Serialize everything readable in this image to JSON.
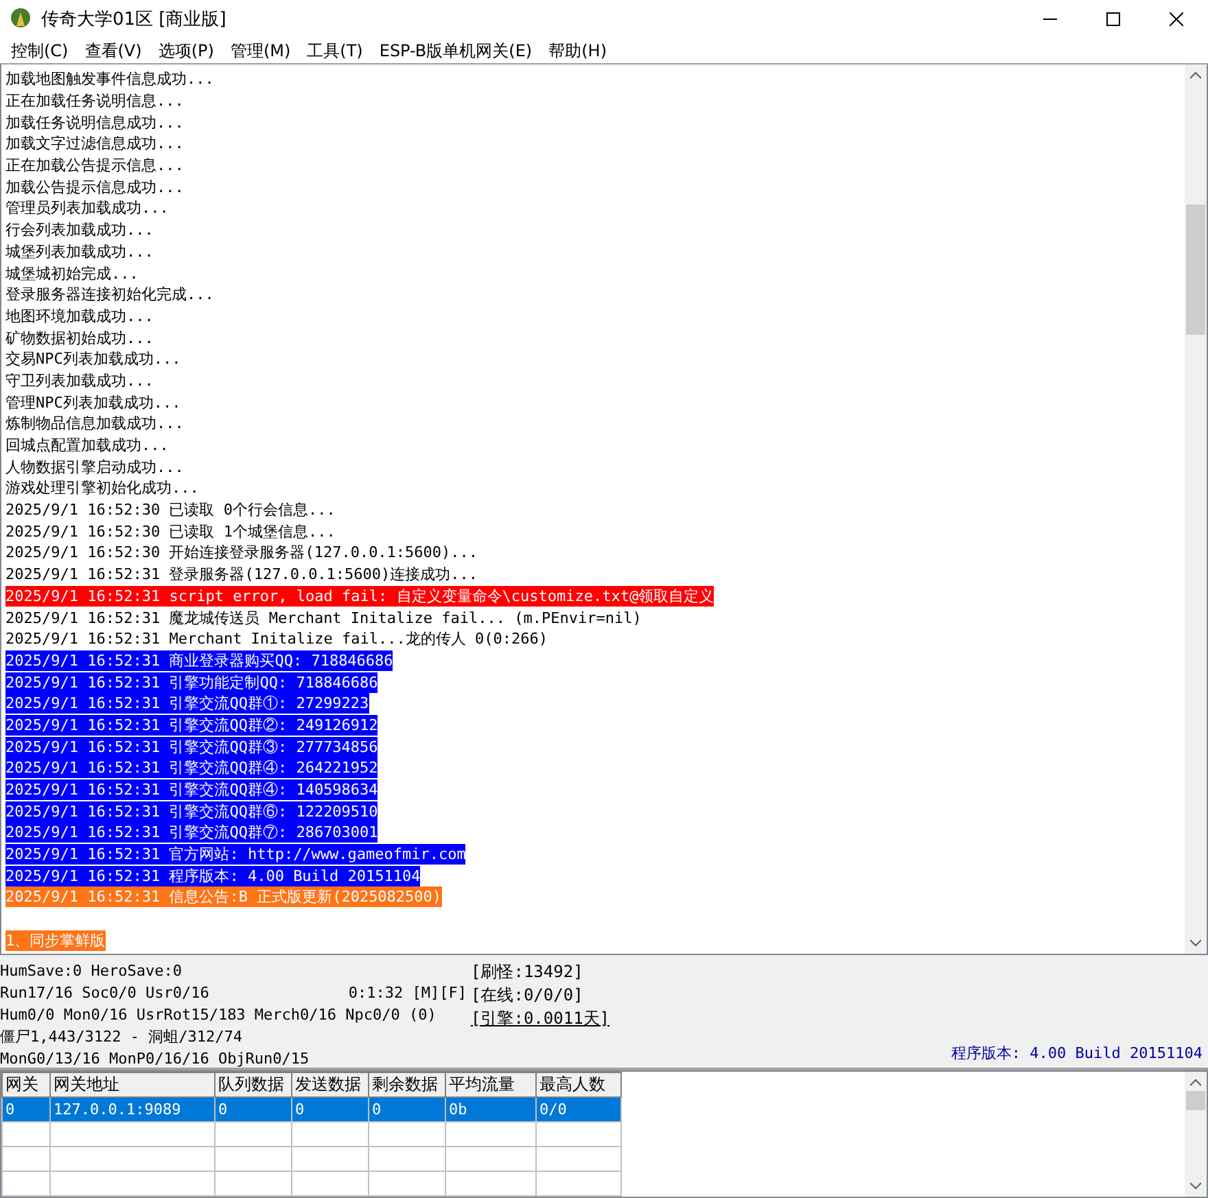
{
  "window": {
    "title": "传奇大学01区 [商业版]"
  },
  "menu": [
    "控制(C)",
    "查看(V)",
    "选项(P)",
    "管理(M)",
    "工具(T)",
    "ESP-B版单机网关(E)",
    "帮助(H)"
  ],
  "log": [
    {
      "text": "加载地图触发事件信息成功...",
      "kind": "normal"
    },
    {
      "text": "正在加载任务说明信息...",
      "kind": "normal"
    },
    {
      "text": "加载任务说明信息成功...",
      "kind": "normal"
    },
    {
      "text": "加载文字过滤信息成功...",
      "kind": "normal"
    },
    {
      "text": "正在加载公告提示信息...",
      "kind": "normal"
    },
    {
      "text": "加载公告提示信息成功...",
      "kind": "normal"
    },
    {
      "text": "管理员列表加载成功...",
      "kind": "normal"
    },
    {
      "text": "行会列表加载成功...",
      "kind": "normal"
    },
    {
      "text": "城堡列表加载成功...",
      "kind": "normal"
    },
    {
      "text": "城堡城初始完成...",
      "kind": "normal"
    },
    {
      "text": "登录服务器连接初始化完成...",
      "kind": "normal"
    },
    {
      "text": "地图环境加载成功...",
      "kind": "normal"
    },
    {
      "text": "矿物数据初始成功...",
      "kind": "normal"
    },
    {
      "text": "交易NPC列表加载成功...",
      "kind": "normal"
    },
    {
      "text": "守卫列表加载成功...",
      "kind": "normal"
    },
    {
      "text": "管理NPC列表加载成功...",
      "kind": "normal"
    },
    {
      "text": "炼制物品信息加载成功...",
      "kind": "normal"
    },
    {
      "text": "回城点配置加载成功...",
      "kind": "normal"
    },
    {
      "text": "人物数据引擎启动成功...",
      "kind": "normal"
    },
    {
      "text": "游戏处理引擎初始化成功...",
      "kind": "normal"
    },
    {
      "text": "2025/9/1 16:52:30 已读取 0个行会信息...",
      "kind": "normal"
    },
    {
      "text": "2025/9/1 16:52:30 已读取 1个城堡信息...",
      "kind": "normal"
    },
    {
      "text": "2025/9/1 16:52:30 开始连接登录服务器(127.0.0.1:5600)...",
      "kind": "normal"
    },
    {
      "text": "2025/9/1 16:52:31 登录服务器(127.0.0.1:5600)连接成功...",
      "kind": "normal"
    },
    {
      "text": "2025/9/1 16:52:31 script error, load fail: 自定义变量命令\\customize.txt@领取自定义",
      "kind": "error"
    },
    {
      "text": "2025/9/1 16:52:31 魔龙城传送员 Merchant Initalize fail... (m.PEnvir=nil)",
      "kind": "normal"
    },
    {
      "text": "2025/9/1 16:52:31 Merchant Initalize fail...龙的传人 0(0:266)",
      "kind": "normal"
    },
    {
      "text": "2025/9/1 16:52:31 商业登录器购买QQ: 718846686",
      "kind": "info"
    },
    {
      "text": "2025/9/1 16:52:31 引擎功能定制QQ: 718846686",
      "kind": "info"
    },
    {
      "text": "2025/9/1 16:52:31 引擎交流QQ群①: 27299223",
      "kind": "info"
    },
    {
      "text": "2025/9/1 16:52:31 引擎交流QQ群②: 249126912",
      "kind": "info"
    },
    {
      "text": "2025/9/1 16:52:31 引擎交流QQ群③: 277734856",
      "kind": "info"
    },
    {
      "text": "2025/9/1 16:52:31 引擎交流QQ群④: 264221952",
      "kind": "info"
    },
    {
      "text": "2025/9/1 16:52:31 引擎交流QQ群④: 140598634",
      "kind": "info"
    },
    {
      "text": "2025/9/1 16:52:31 引擎交流QQ群⑥: 122209510",
      "kind": "info"
    },
    {
      "text": "2025/9/1 16:52:31 引擎交流QQ群⑦: 286703001",
      "kind": "info"
    },
    {
      "text": "2025/9/1 16:52:31 官方网站: http://www.gameofmir.com",
      "kind": "info"
    },
    {
      "text": "2025/9/1 16:52:31 程序版本: 4.00 Build 20151104",
      "kind": "info"
    },
    {
      "text": "2025/9/1 16:52:31 信息公告:B 正式版更新(2025082500)",
      "kind": "notice"
    },
    {
      "kind": "blank"
    },
    {
      "text": "1、同步掌鲜版",
      "kind": "notice"
    }
  ],
  "status": {
    "lines": [
      "HumSave:0 HeroSave:0",
      "Run17/16 Soc0/0 Usr0/16",
      "Hum0/0 Mon0/16 UsrRot15/183 Merch0/16 Npc0/0 (0)",
      "僵尸1,443/3122 - 洞蛆/312/74",
      "MonG0/13/16 MonP0/16/16 ObjRun0/15"
    ],
    "clock": "0:1:32 [M][F]",
    "counters": [
      {
        "text": "[刷怪:13492]",
        "kind": "plain"
      },
      {
        "text": "[在线:0/0/0]",
        "kind": "plain"
      },
      {
        "text": "[引擎:0.0011天]",
        "kind": "link"
      }
    ],
    "version": "程序版本: 4.00 Build 20151104"
  },
  "gateways": {
    "columns": [
      "网关",
      "网关地址",
      "队列数据",
      "发送数据",
      "剩余数据",
      "平均流量",
      "最高人数"
    ],
    "rows": [
      {
        "cells": [
          "0",
          "127.0.0.1:9089",
          "0",
          "0",
          "0",
          "0b",
          "0/0"
        ],
        "selected": true
      }
    ]
  }
}
